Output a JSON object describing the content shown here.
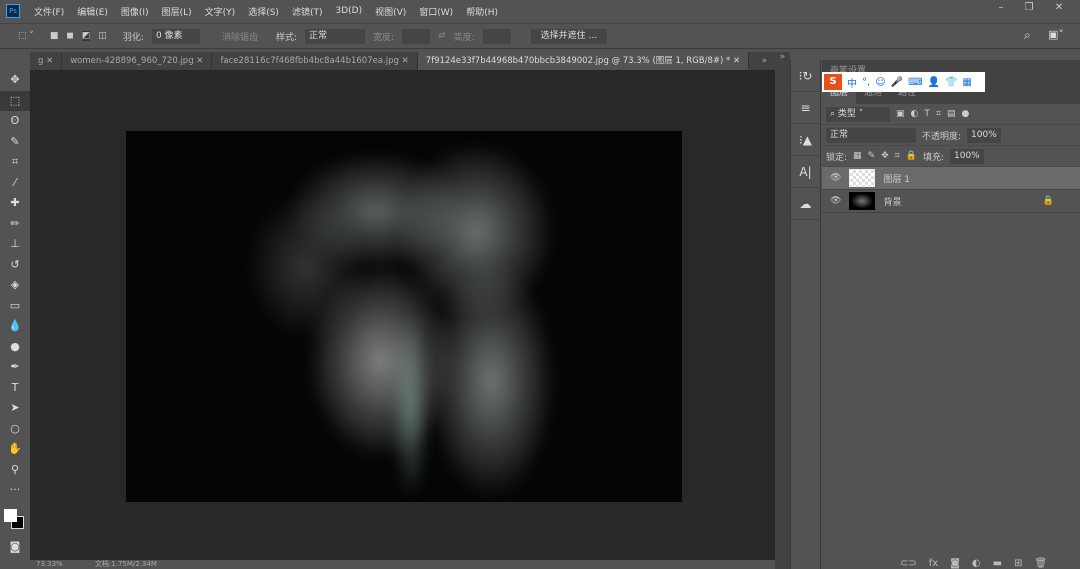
{
  "menu": [
    "文件(F)",
    "编辑(E)",
    "图像(I)",
    "图层(L)",
    "文字(Y)",
    "选择(S)",
    "滤镜(T)",
    "3D(D)",
    "视图(V)",
    "窗口(W)",
    "帮助(H)"
  ],
  "app_icon": "Ps",
  "options": {
    "feather_label": "羽化:",
    "feather_value": "0 像素",
    "antialias": "消除锯齿",
    "style_label": "样式:",
    "style_value": "正常",
    "width_label": "宽度:",
    "height_label": "高度:",
    "select_mask": "选择并遮住 ..."
  },
  "tabs": [
    "g",
    "women-428896_960_720.jpg",
    "face28116c7f468fbb4bc8a44b1607ea.jpg",
    "7f9124e33f7b44968b470bbcb3849002.jpg @ 73.3% (图层 1, RGB/8#) *"
  ],
  "status": {
    "zoom": "73.33%",
    "doc": "文档:1.75M/2.34M"
  },
  "panel": {
    "top_tab": "画笔设置",
    "tabs": [
      "图层",
      "通道",
      "路径"
    ],
    "filter": "类型",
    "blend": "正常",
    "opacity_label": "不透明度:",
    "opacity": "100%",
    "lock_label": "锁定:",
    "fill_label": "填充:",
    "fill": "100%",
    "layers": [
      {
        "name": "图层 1"
      },
      {
        "name": "背景"
      }
    ]
  },
  "ime": {
    "logo": "S",
    "mode": "中"
  }
}
